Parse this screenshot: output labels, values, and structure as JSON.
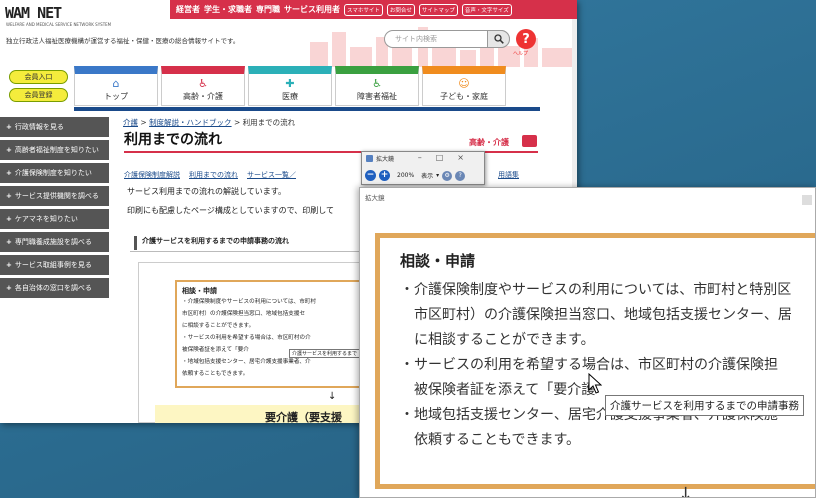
{
  "header": {
    "logo": "WAM NET",
    "logo_sub": "WELFARE AND MEDICAL SERVICE NETWORK SYSTEM",
    "links": [
      "経営者",
      "学生・求職者",
      "専門職",
      "サービス利用者"
    ],
    "buttons": [
      "スマホサイト",
      "お問合せ",
      "サイトマップ",
      "音声・文字サイズ"
    ],
    "tagline": "独立行政法人福祉医療機構が運営する福祉・保健・医療の総合情報サイトです。",
    "search_placeholder": "サイト内検索",
    "help_label": "ヘルプ"
  },
  "member": {
    "login": "会員入口",
    "register": "会員登録"
  },
  "nav_tabs": [
    {
      "label": "トップ",
      "color": "#3a78c8",
      "icon": "⌂"
    },
    {
      "label": "高齢・介護",
      "color": "#d6304a",
      "icon": "♿"
    },
    {
      "label": "医療",
      "color": "#2bb0b8",
      "icon": "✚"
    },
    {
      "label": "障害者福祉",
      "color": "#3aa040",
      "icon": "♿"
    },
    {
      "label": "子ども・家庭",
      "color": "#f08c1e",
      "icon": "☺"
    }
  ],
  "sidebar": [
    "行政情報を見る",
    "高齢者福祉制度を知りたい",
    "介護保険制度を知りたい",
    "サービス提供機関を調べる",
    "ケアマネを知りたい",
    "専門職養成施設を調べる",
    "サービス取組事例を見る",
    "各自治体の窓口を調べる"
  ],
  "breadcrumb": [
    "介護",
    "制度解説・ハンドブック",
    "利用までの流れ"
  ],
  "page_title": "利用までの流れ",
  "category": "高齢・介護",
  "subnav": [
    "介護保険制度解説",
    "利用までの流れ",
    "サービス一覧／"
  ],
  "glossary": "用語集",
  "intro": "サービス利用までの流れの解説しています。",
  "intro2": "印刷にも配慮したページ構成としていますので、印刷して",
  "section_title": "介護サービスを利用するまでの申請事務の流れ",
  "small_box": {
    "heading": "相談・申請",
    "lines": [
      "・介護保険制度やサービスの利用については、市町村",
      "市区町村）の介護保険担当窓口、地域包括支援セ",
      "に相談することができます。",
      "・サービスの利用を希望する場合は、市区町村の介",
      "被保険者証を添えて「要介",
      "・地域包括支援センター、居宅介護支援事業者、介",
      "依頼することもできます。"
    ],
    "tooltip": "介護サービスを利用するまで"
  },
  "next_step": "要介護（要支援",
  "magnifier_toolbar": {
    "title": "拡大鏡",
    "zoom": "200%",
    "view": "表示"
  },
  "magnifier_window": {
    "title": "拡大鏡",
    "heading": "相談・申請",
    "lines": [
      "・介護保険制度やサービスの利用については、市町村と特別区",
      "　市区町村）の介護保険担当窓口、地域包括支援センター、居",
      "　に相談することができます。",
      "・サービスの利用を希望する場合は、市区町村の介護保険担",
      "　被保険者証を添えて「要介護",
      "・地域包括支援センター、居宅介護支援事業者、介護保険施",
      "　依頼することもできます。"
    ],
    "tooltip": "介護サービスを利用するまでの申請事務"
  }
}
